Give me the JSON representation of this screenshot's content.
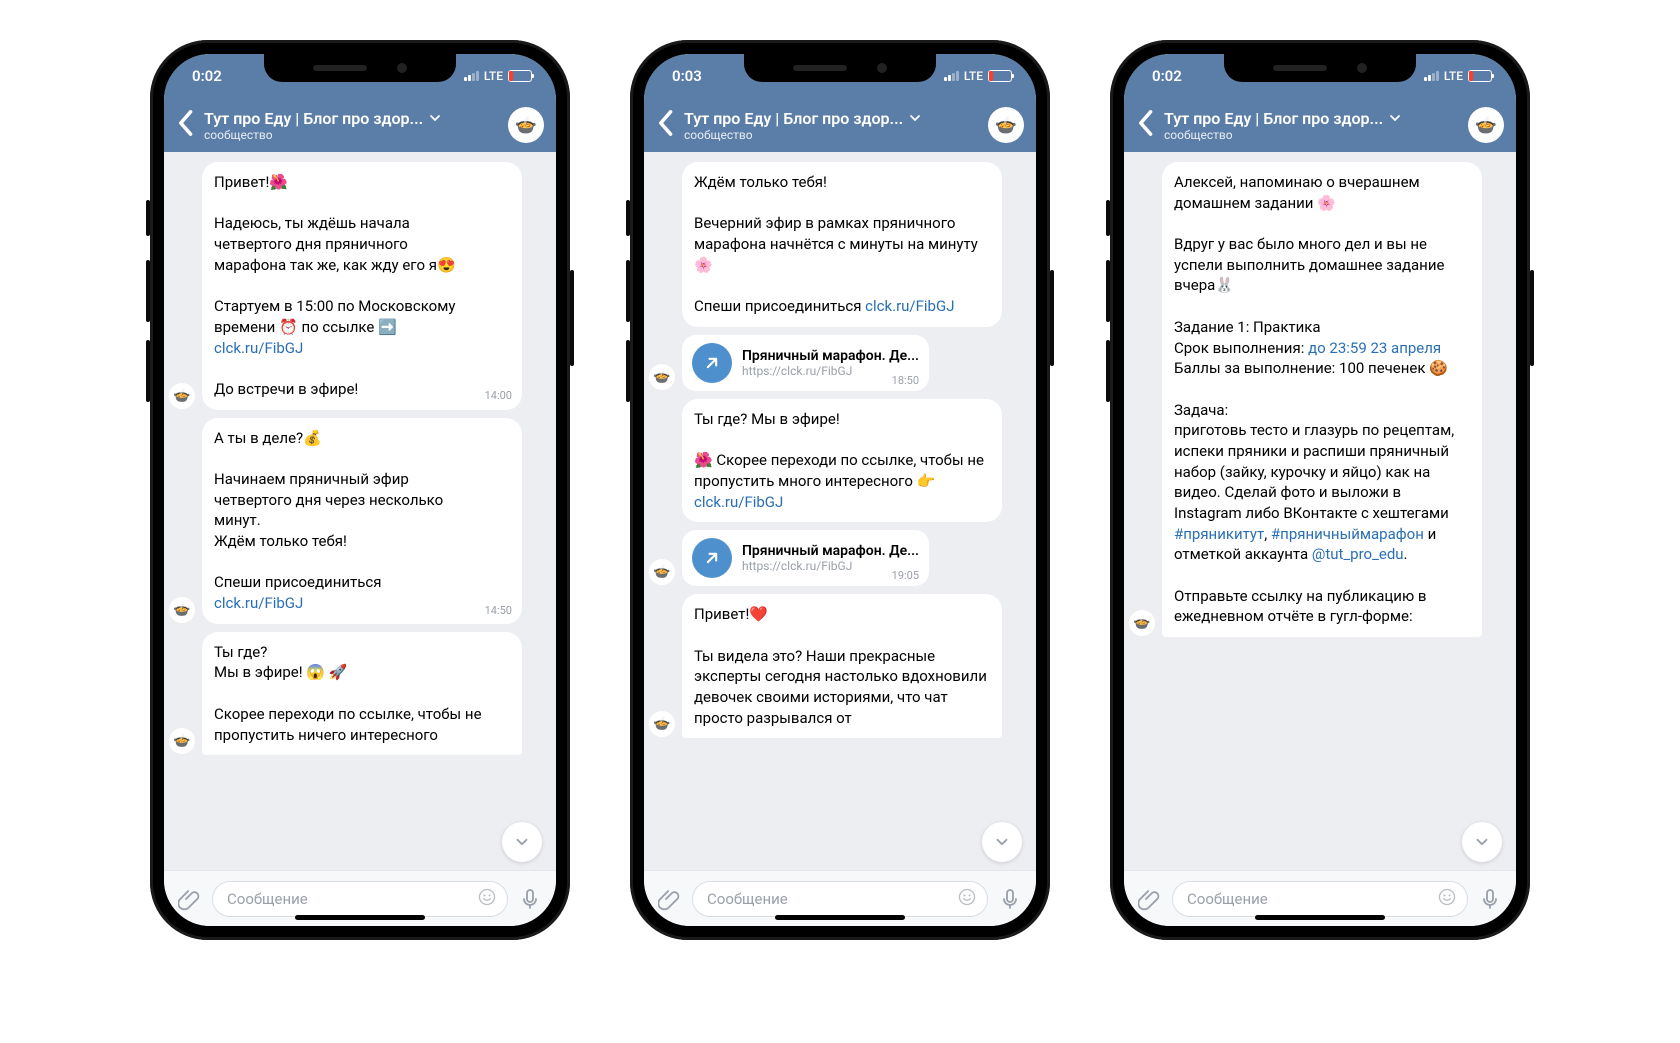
{
  "status": {
    "lte": "LTE"
  },
  "header": {
    "title": "Тут про Еду | Блог про здор...",
    "subtitle": "сообщество"
  },
  "input": {
    "placeholder": "Сообщение"
  },
  "phones": [
    {
      "time": "0:02",
      "messages": [
        {
          "type": "bubble",
          "withAvatar": true,
          "ts": "14:00",
          "parts": [
            {
              "t": "text",
              "v": "Привет!🌺"
            },
            {
              "t": "br2"
            },
            {
              "t": "text",
              "v": "Надеюсь, ты ждёшь начала четвертого дня пряничного марафона так же, как жду его я😍"
            },
            {
              "t": "br2"
            },
            {
              "t": "text",
              "v": "Стартуем в  15:00 по Московскому времени ⏰ по ссылке ➡️ "
            },
            {
              "t": "link",
              "v": "clck.ru/FibGJ"
            },
            {
              "t": "br2"
            },
            {
              "t": "text",
              "v": "До встречи в эфире!"
            }
          ]
        },
        {
          "type": "bubble",
          "withAvatar": true,
          "ts": "14:50",
          "parts": [
            {
              "t": "text",
              "v": "А ты в деле?💰"
            },
            {
              "t": "br2"
            },
            {
              "t": "text",
              "v": "Начинаем пряничный эфир четвертого дня через несколько минут."
            },
            {
              "t": "br"
            },
            {
              "t": "text",
              "v": "Ждём только тебя!"
            },
            {
              "t": "br2"
            },
            {
              "t": "text",
              "v": "Спеши присоединиться "
            },
            {
              "t": "link",
              "v": "clck.ru/FibGJ"
            }
          ]
        },
        {
          "type": "bubble",
          "withAvatar": true,
          "cut": true,
          "parts": [
            {
              "t": "text",
              "v": "Ты где?"
            },
            {
              "t": "br"
            },
            {
              "t": "text",
              "v": "Мы в эфире! 😱 🚀"
            },
            {
              "t": "br2"
            },
            {
              "t": "text",
              "v": " Скорее переходи по ссылке, чтобы не пропустить ничего интересного"
            }
          ]
        }
      ]
    },
    {
      "time": "0:03",
      "messages": [
        {
          "type": "bubble",
          "withAvatar": false,
          "parts": [
            {
              "t": "text",
              "v": "Ждём только тебя!"
            },
            {
              "t": "br2"
            },
            {
              "t": "text",
              "v": "Вечерний эфир в рамках пряничного марафона начнётся с минуты на минуту 🌸"
            },
            {
              "t": "br2"
            },
            {
              "t": "text",
              "v": "Спеши присоединиться "
            },
            {
              "t": "link",
              "v": "clck.ru/FibGJ"
            }
          ]
        },
        {
          "type": "linkcard",
          "withAvatar": true,
          "title": "Пряничный марафон. Де...",
          "url": "https://clck.ru/FibGJ",
          "ts": "18:50"
        },
        {
          "type": "bubble",
          "withAvatar": false,
          "parts": [
            {
              "t": "text",
              "v": "Ты где? Мы в эфире!"
            },
            {
              "t": "br2"
            },
            {
              "t": "text",
              "v": "🌺 Скорее переходи по ссылке, чтобы не пропустить много интересного 👉  "
            },
            {
              "t": "link",
              "v": "clck.ru/FibGJ"
            }
          ]
        },
        {
          "type": "linkcard",
          "withAvatar": true,
          "title": "Пряничный марафон. Де...",
          "url": "https://clck.ru/FibGJ",
          "ts": "19:05"
        },
        {
          "type": "bubble",
          "withAvatar": true,
          "cut": true,
          "parts": [
            {
              "t": "text",
              "v": "Привет!❤️"
            },
            {
              "t": "br2"
            },
            {
              "t": "text",
              "v": "Ты видела это? Наши прекрасные эксперты сегодня настолько вдохновили девочек своими историями, что чат просто разрывался от"
            }
          ]
        }
      ]
    },
    {
      "time": "0:02",
      "messages": [
        {
          "type": "bubble",
          "withAvatar": true,
          "cut": true,
          "parts": [
            {
              "t": "text",
              "v": "Алексей, напоминаю о вчерашнем домашнем задании 🌸"
            },
            {
              "t": "br2"
            },
            {
              "t": "text",
              "v": "Вдруг у вас было много дел и вы не успели выполнить домашнее задание вчера🐰"
            },
            {
              "t": "br2"
            },
            {
              "t": "text",
              "v": "Задание 1: Практика"
            },
            {
              "t": "br"
            },
            {
              "t": "text",
              "v": "Срок выполнения: "
            },
            {
              "t": "link",
              "v": "до 23:59 23 апреля"
            },
            {
              "t": "br"
            },
            {
              "t": "text",
              "v": "Баллы за выполнение: 100 печенек 🍪"
            },
            {
              "t": "br2"
            },
            {
              "t": "text",
              "v": "Задача:"
            },
            {
              "t": "br"
            },
            {
              "t": "text",
              "v": "приготовь тесто и глазурь по рецептам, испеки пряники и распиши пряничный набор (зайку, курочку и яйцо) как на видео. Сделай фото и выложи в Instagram либо ВКонтакте с хештегами "
            },
            {
              "t": "hash",
              "v": "#пряникитут"
            },
            {
              "t": "text",
              "v": ", "
            },
            {
              "t": "hash",
              "v": "#пряничныймарафон"
            },
            {
              "t": "text",
              "v": " и отметкой аккаунта "
            },
            {
              "t": "link",
              "v": "@tut_pro_edu"
            },
            {
              "t": "text",
              "v": "."
            },
            {
              "t": "br2"
            },
            {
              "t": "text",
              "v": "Отправьте ссылку на публикацию в ежедневном отчёте в гугл-форме:"
            }
          ]
        }
      ]
    }
  ]
}
